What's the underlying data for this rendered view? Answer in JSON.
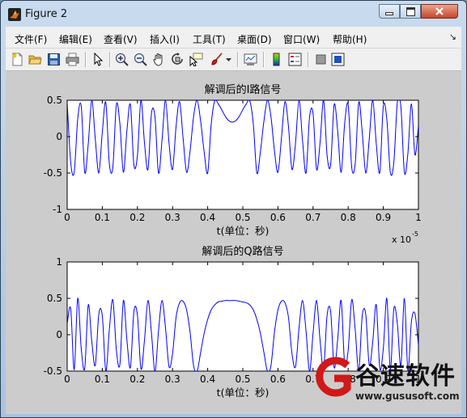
{
  "window": {
    "title": "Figure 2",
    "minimize_icon": "minimize-icon",
    "maximize_icon": "maximize-icon",
    "close_icon": "close-icon"
  },
  "menu": [
    {
      "label": "文件(F)"
    },
    {
      "label": "编辑(E)"
    },
    {
      "label": "查看(V)"
    },
    {
      "label": "插入(I)"
    },
    {
      "label": "工具(T)"
    },
    {
      "label": "桌面(D)"
    },
    {
      "label": "窗口(W)"
    },
    {
      "label": "帮助(H)"
    }
  ],
  "toolbar": {
    "icons": [
      "new-figure-icon",
      "open-folder-icon",
      "save-icon",
      "print-icon",
      "select-arrow-icon",
      "zoom-in-icon",
      "zoom-out-icon",
      "pan-hand-icon",
      "rotate-3d-icon",
      "data-cursor-icon",
      "brush-icon",
      "brush-dropdown-icon",
      "link-plot-icon",
      "colorbar-icon",
      "legend-icon",
      "hide-plot-tools-icon",
      "show-plot-tools-icon"
    ]
  },
  "chart_data": [
    {
      "type": "line",
      "title": "解调后的I路信号",
      "xlabel": "t(单位：秒)",
      "x_multiplier": "x 10",
      "x_multiplier_exp": "-5",
      "ylabel": "",
      "xlim": [
        0,
        1
      ],
      "ylim": [
        -1,
        0.5
      ],
      "xticks": [
        "0",
        "0.1",
        "0.2",
        "0.3",
        "0.4",
        "0.5",
        "0.6",
        "0.7",
        "0.8",
        "0.9",
        "1"
      ],
      "yticks": [
        "-1",
        "-0.5",
        "0",
        "0.5"
      ],
      "color": "#0000ff",
      "x": [
        0,
        0.01,
        0.02,
        0.03,
        0.04,
        0.05,
        0.06,
        0.07,
        0.08,
        0.09,
        0.1,
        0.11,
        0.12,
        0.13,
        0.14,
        0.15,
        0.16,
        0.17,
        0.18,
        0.19,
        0.2,
        0.21,
        0.22,
        0.23,
        0.24,
        0.25,
        0.26,
        0.27,
        0.28,
        0.29,
        0.3,
        0.31,
        0.32,
        0.33,
        0.34,
        0.35,
        0.36,
        0.37,
        0.38,
        0.39,
        0.4,
        0.41,
        0.42,
        0.43,
        0.44,
        0.45,
        0.46,
        0.47,
        0.48,
        0.49,
        0.5,
        0.51,
        0.52,
        0.53,
        0.54,
        0.55,
        0.56,
        0.57,
        0.58,
        0.59,
        0.6,
        0.61,
        0.62,
        0.63,
        0.64,
        0.65,
        0.66,
        0.67,
        0.68,
        0.69,
        0.7,
        0.71,
        0.72,
        0.73,
        0.74,
        0.75,
        0.76,
        0.77,
        0.78,
        0.79,
        0.8,
        0.81,
        0.82,
        0.83,
        0.84,
        0.85,
        0.86,
        0.87,
        0.88,
        0.89,
        0.9,
        0.91,
        0.92,
        0.93,
        0.94,
        0.95,
        0.96,
        0.97,
        0.98,
        0.99,
        1
      ],
      "y": [
        0.47,
        -0.35,
        -0.49,
        0.24,
        0.42,
        -0.49,
        -0.1,
        0.5,
        -0.03,
        -0.5,
        0.06,
        0.47,
        -0.37,
        -0.42,
        0.44,
        0.18,
        -0.49,
        0.08,
        0.44,
        -0.39,
        -0.26,
        0.5,
        -0.08,
        -0.45,
        0.32,
        0.27,
        -0.5,
        -0.05,
        0.5,
        -0.09,
        -0.45,
        0.14,
        0.48,
        -0.02,
        -0.49,
        -0.19,
        0.28,
        0.5,
        0.21,
        -0.21,
        -0.5,
        0.17,
        0.49,
        0.45,
        0.37,
        0.28,
        0.22,
        0.2,
        0.22,
        0.28,
        0.37,
        0.45,
        0.49,
        0.17,
        -0.5,
        -0.21,
        0.21,
        0.5,
        0.28,
        -0.19,
        -0.49,
        -0.02,
        0.48,
        0.14,
        -0.45,
        -0.09,
        0.5,
        -0.05,
        -0.5,
        0.27,
        0.32,
        -0.45,
        -0.08,
        0.5,
        -0.26,
        -0.39,
        0.44,
        0.08,
        -0.49,
        0.18,
        0.44,
        -0.42,
        -0.37,
        0.47,
        0.06,
        -0.5,
        -0.03,
        0.5,
        -0.1,
        -0.49,
        0.42,
        0.24,
        -0.49,
        -0.35,
        0.47,
        0.41,
        -0.49,
        -0.23,
        0.45,
        -0.25,
        0.15
      ]
    },
    {
      "type": "line",
      "title": "解调后的Q路信号",
      "xlabel": "t(单位：秒)",
      "ylabel": "",
      "xlim": [
        0,
        1
      ],
      "ylim": [
        -0.5,
        1
      ],
      "xticks": [
        "0",
        "0.1",
        "0.2",
        "0.3",
        "0.4",
        "0.5",
        "0.6",
        "0.7",
        "0.8",
        "0.9",
        "1"
      ],
      "yticks": [
        "-0.5",
        "0",
        "0.5",
        "1"
      ],
      "color": "#0000ff",
      "x": [
        0,
        0.01,
        0.02,
        0.03,
        0.04,
        0.05,
        0.06,
        0.07,
        0.08,
        0.09,
        0.1,
        0.11,
        0.12,
        0.13,
        0.14,
        0.15,
        0.16,
        0.17,
        0.18,
        0.19,
        0.2,
        0.21,
        0.22,
        0.23,
        0.24,
        0.25,
        0.26,
        0.27,
        0.28,
        0.29,
        0.3,
        0.31,
        0.32,
        0.33,
        0.34,
        0.35,
        0.36,
        0.37,
        0.38,
        0.39,
        0.4,
        0.41,
        0.42,
        0.43,
        0.44,
        0.45,
        0.46,
        0.47,
        0.48,
        0.49,
        0.5,
        0.51,
        0.52,
        0.53,
        0.54,
        0.55,
        0.56,
        0.57,
        0.58,
        0.59,
        0.6,
        0.61,
        0.62,
        0.63,
        0.64,
        0.65,
        0.66,
        0.67,
        0.68,
        0.69,
        0.7,
        0.71,
        0.72,
        0.73,
        0.74,
        0.75,
        0.76,
        0.77,
        0.78,
        0.79,
        0.8,
        0.81,
        0.82,
        0.83,
        0.84,
        0.85,
        0.86,
        0.87,
        0.88,
        0.89,
        0.9,
        0.91,
        0.92,
        0.93,
        0.94,
        0.95,
        0.96,
        0.97,
        0.98,
        0.99,
        1
      ],
      "y": [
        0.15,
        0.36,
        -0.48,
        0.5,
        -0.19,
        -0.46,
        0.41,
        -0.09,
        -0.42,
        0.28,
        0.26,
        -0.5,
        0.07,
        0.48,
        -0.21,
        -0.41,
        0.47,
        -0.07,
        -0.45,
        0.32,
        0.27,
        -0.47,
        -0.08,
        0.47,
        0.02,
        -0.5,
        0.05,
        0.47,
        0.09,
        -0.44,
        -0.26,
        0.24,
        0.44,
        0.46,
        0.34,
        0.03,
        -0.43,
        -0.5,
        -0.24,
        0.02,
        0.21,
        0.34,
        0.41,
        0.45,
        0.46,
        0.47,
        0.47,
        0.47,
        0.47,
        0.46,
        0.45,
        0.44,
        0.41,
        0.34,
        0.21,
        0.02,
        -0.24,
        -0.5,
        -0.43,
        0.03,
        0.34,
        0.46,
        0.44,
        0.24,
        -0.26,
        -0.44,
        0.09,
        0.47,
        0.05,
        -0.5,
        0.02,
        0.47,
        -0.08,
        -0.47,
        0.27,
        0.32,
        -0.45,
        -0.07,
        0.47,
        -0.41,
        -0.21,
        0.48,
        0.07,
        -0.5,
        0.26,
        0.28,
        -0.42,
        -0.09,
        0.41,
        -0.46,
        -0.19,
        0.5,
        -0.48,
        0.36,
        0.15,
        -0.43,
        0.5,
        -0.49,
        0.18,
        0.29,
        -0.14
      ]
    }
  ],
  "watermark": {
    "brand": "谷速软件",
    "url": "www.gususoft.com"
  }
}
